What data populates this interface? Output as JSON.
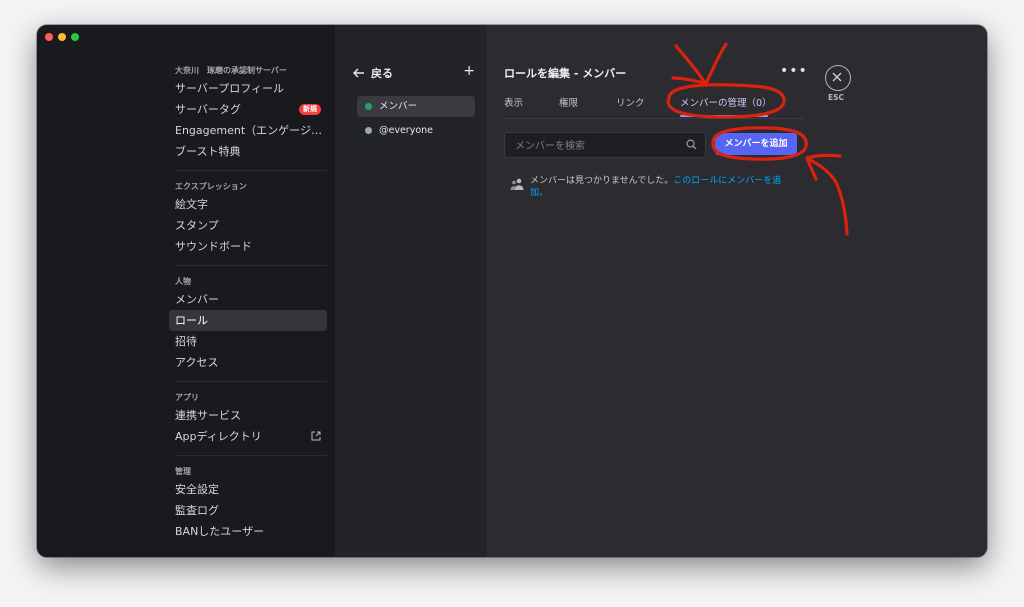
{
  "colors": {
    "accent": "#5865f2",
    "annotation": "#d9230f",
    "member_role": "#23a55a",
    "everyone_role": "#99aab5",
    "new_badge": "#f23f43",
    "link": "#00a8fc"
  },
  "sidebar": {
    "server_name": "大奈川　琢磨の承認制サーバー",
    "sections": [
      {
        "items": [
          {
            "label": "サーバープロフィール"
          },
          {
            "label": "サーバータグ",
            "badge": "新規"
          },
          {
            "label": "Engagement（エンゲージメ..."
          },
          {
            "label": "ブースト特典"
          }
        ]
      },
      {
        "header": "エクスプレッション",
        "items": [
          {
            "label": "絵文字"
          },
          {
            "label": "スタンプ"
          },
          {
            "label": "サウンドボード"
          }
        ]
      },
      {
        "header": "人物",
        "items": [
          {
            "label": "メンバー"
          },
          {
            "label": "ロール",
            "active": true
          },
          {
            "label": "招待"
          },
          {
            "label": "アクセス"
          }
        ]
      },
      {
        "header": "アプリ",
        "items": [
          {
            "label": "連携サービス"
          },
          {
            "label": "Appディレクトリ",
            "icon": "external-link-icon"
          }
        ]
      },
      {
        "header": "管理",
        "items": [
          {
            "label": "安全設定"
          },
          {
            "label": "監査ログ"
          },
          {
            "label": "BANしたユーザー"
          }
        ]
      }
    ]
  },
  "roles_panel": {
    "back_label": "戻る",
    "add_icon": "+",
    "roles": [
      {
        "label": "メンバー",
        "active": true
      },
      {
        "label": "@everyone",
        "active": false
      }
    ]
  },
  "main": {
    "title": "ロールを編集 - メンバー",
    "more_icon": "•••",
    "esc_label": "ESC",
    "tabs": [
      "表示",
      "権限",
      "リンク",
      "メンバーの管理（0）"
    ],
    "active_tab": 3,
    "search_placeholder": "メンバーを検索",
    "add_button": "メンバーを追加",
    "empty_text": "メンバーは見つかりませんでした。",
    "empty_link": "このロールにメンバーを追加。"
  }
}
